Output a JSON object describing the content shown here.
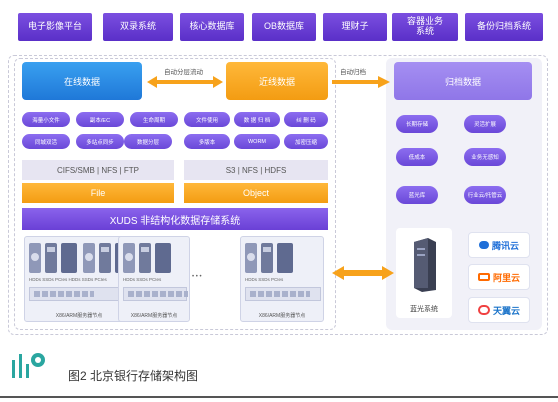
{
  "top_systems": [
    "电子影像平台",
    "双录系统",
    "核心数据库",
    "OB数据库",
    "理财子",
    "容器业务\n系统",
    "备份归档系统"
  ],
  "online": {
    "title": "在线数据"
  },
  "flow_label": "自动分层流动",
  "nearline": {
    "title": "近线数据"
  },
  "archive_label": "自动归档",
  "archive": {
    "title": "归档数据",
    "features": [
      "长期存储",
      "灵活扩展",
      "低成本",
      "业务无感知",
      "蓝光库",
      "行业云/托管云"
    ]
  },
  "file_features_row1": [
    "海量小文件",
    "副本/EC",
    "生命周期"
  ],
  "file_features_row2": [
    "同城双活",
    "多站点同步",
    "数据分层"
  ],
  "object_features_row1": [
    "文件使用",
    "数 据 归 档",
    "纠 删 码"
  ],
  "object_features_row2": [
    "多版本",
    "WORM",
    "加密压缩"
  ],
  "protocols": {
    "file": "CIFS/SMB | NFS | FTP",
    "object": "S3 | NFS | HDFS"
  },
  "bars": {
    "file": "File",
    "object": "Object"
  },
  "xuds": "XUDS 非结构化数据存储系统",
  "servers": [
    {
      "types": "HDDs SSDs PCIes HDDs SSDs PCIes",
      "name": "X86/ARM服务器节点"
    },
    {
      "types": "HDDs SSDs PCIes",
      "name": "X86/ARM服务器节点"
    },
    {
      "types": "HDDs SSDs PCIes",
      "name": "X86/ARM服务器节点"
    }
  ],
  "dots": "• • •",
  "bluray": {
    "name": "蓝光系统"
  },
  "clouds": [
    {
      "name": "腾讯云",
      "color": "#1f6fd8"
    },
    {
      "name": "阿里云",
      "color": "#ff6a00"
    },
    {
      "name": "天翼云",
      "color": "#1a73c9"
    }
  ],
  "caption": "图2 北京银行存储架构图",
  "colors": {
    "purple": "#6a48d8",
    "blue": "#2d8be8",
    "orange": "#f7a21b",
    "arrow": "#f7a21b"
  }
}
